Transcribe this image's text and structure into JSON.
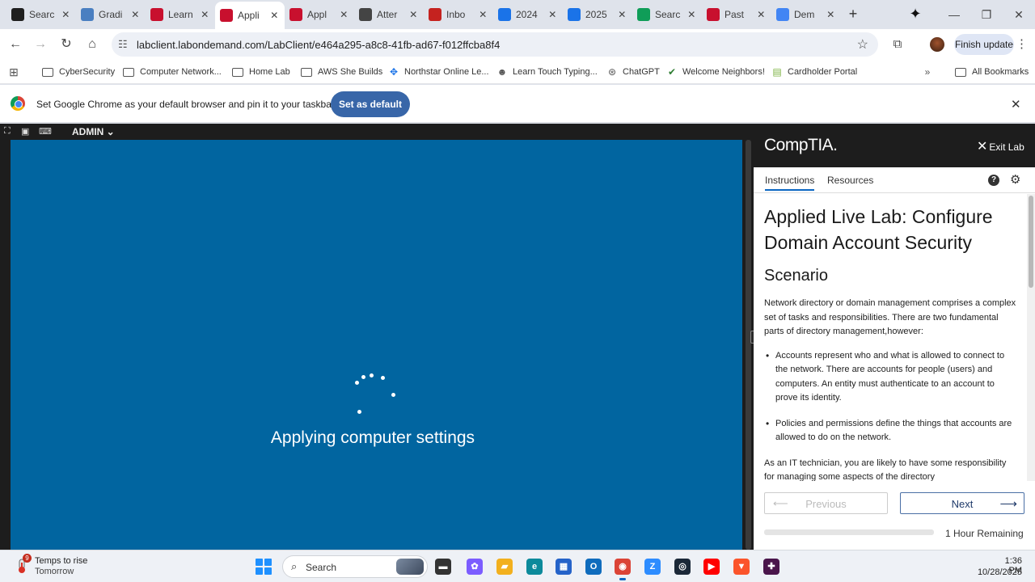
{
  "browser": {
    "tabs": [
      {
        "label": "Searc",
        "icon": "sheets-icon",
        "color": "#1f1f1f",
        "active": false
      },
      {
        "label": "Gradi",
        "icon": "grammarly-icon",
        "color": "#4a7fc1",
        "active": false
      },
      {
        "label": "Learn",
        "icon": "comptia-icon",
        "color": "#c8102e",
        "active": false
      },
      {
        "label": "Appli",
        "icon": "comptia-icon",
        "color": "#c8102e",
        "active": true
      },
      {
        "label": "Appl",
        "icon": "comptia-icon",
        "color": "#c8102e",
        "active": false
      },
      {
        "label": "Atter",
        "icon": "globe-icon",
        "color": "#444444",
        "active": false
      },
      {
        "label": "Inbo",
        "icon": "gmail-icon",
        "color": "#c5221f",
        "active": false
      },
      {
        "label": "2024",
        "icon": "web-icon",
        "color": "#1a73e8",
        "active": false
      },
      {
        "label": "2025",
        "icon": "docs-icon",
        "color": "#1a73e8",
        "active": false
      },
      {
        "label": "Searc",
        "icon": "drive-icon",
        "color": "#0f9d58",
        "active": false
      },
      {
        "label": "Past",
        "icon": "shield-icon",
        "color": "#c8102e",
        "active": false
      },
      {
        "label": "Dem",
        "icon": "google-icon",
        "color": "#4285f4",
        "active": false
      }
    ],
    "url": "labclient.labondemand.com/LabClient/e464a295-a8c8-41fb-ad67-f012ffcba8f4",
    "finish_update": "Finish update",
    "bookmarks": [
      {
        "label": "CyberSecurity",
        "icon": "folder-icon"
      },
      {
        "label": "Computer Network...",
        "icon": "folder-icon"
      },
      {
        "label": "Home Lab",
        "icon": "folder-icon"
      },
      {
        "label": "AWS She Builds",
        "icon": "folder-icon"
      },
      {
        "label": "Northstar Online Le...",
        "icon": "northstar-icon"
      },
      {
        "label": "Learn Touch Typing...",
        "icon": "typing-icon"
      },
      {
        "label": "ChatGPT",
        "icon": "chatgpt-icon"
      },
      {
        "label": "Welcome Neighbors!",
        "icon": "check-icon"
      },
      {
        "label": "Cardholder Portal",
        "icon": "card-icon"
      }
    ],
    "all_bookmarks": "All Bookmarks",
    "infobar_text": "Set Google Chrome as your default browser and pin it to your taskbar",
    "set_default": "Set as default"
  },
  "lab": {
    "user": "ADMIN",
    "status_text": "Applying computer settings"
  },
  "panel": {
    "logo": "CompTIA.",
    "exit": "Exit Lab",
    "tabs": [
      "Instructions",
      "Resources"
    ],
    "title": "Applied Live Lab: Configure Domain Account Security",
    "scenario_heading": "Scenario",
    "intro": "Network directory or domain management comprises a complex set of tasks and responsibilities. There are two fundamental parts of directory management,however:",
    "bullets": [
      "Accounts represent who and what is allowed to connect to the network. There are accounts for people (users) and computers. An entity must authenticate to an account to prove its identity.",
      "Policies and permissions define the things that accounts are allowed to do on the network."
    ],
    "trailing": "As an IT technician, you are likely to have some responsibility for managing some aspects of the directory",
    "prev": "Previous",
    "next": "Next",
    "remaining": "1 Hour Remaining",
    "progress_fraction": 0.0
  },
  "taskbar": {
    "weather_line1": "Temps to rise",
    "weather_line2": "Tomorrow",
    "weather_badge": "9",
    "search": "Search",
    "time": "1:36 PM",
    "date": "10/28/2025",
    "apps": [
      {
        "name": "task-view-icon",
        "color": "#333333"
      },
      {
        "name": "copilot-icon",
        "color": "#7b5cff"
      },
      {
        "name": "file-explorer-icon",
        "color": "#f2b01e"
      },
      {
        "name": "edge-icon",
        "color": "#0c8a9b"
      },
      {
        "name": "store-icon",
        "color": "#2563c9"
      },
      {
        "name": "outlook-icon",
        "color": "#0f6cbd"
      },
      {
        "name": "chrome-icon",
        "color": "#db4437"
      },
      {
        "name": "zoom-icon",
        "color": "#2d8cff"
      },
      {
        "name": "steam-icon",
        "color": "#1b2838"
      },
      {
        "name": "youtube-icon",
        "color": "#ff0000"
      },
      {
        "name": "brave-icon",
        "color": "#fb542b"
      },
      {
        "name": "slack-icon",
        "color": "#4a154b"
      }
    ]
  }
}
